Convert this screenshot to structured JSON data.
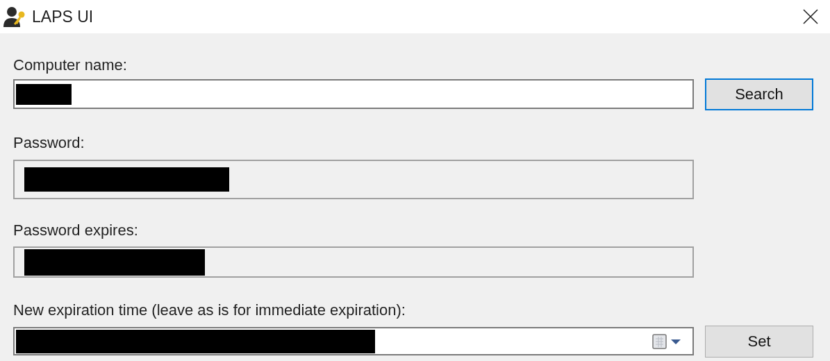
{
  "window": {
    "title": "LAPS UI"
  },
  "fields": [
    {
      "label": "Computer name:",
      "kind": "text",
      "redacted": true,
      "button": {
        "label": "Search",
        "focused": true
      }
    },
    {
      "label": "Password:",
      "kind": "readonly",
      "redacted": true
    },
    {
      "label": "Password expires:",
      "kind": "readonly",
      "redacted": true
    },
    {
      "label": "New expiration time (leave as is for immediate expiration):",
      "kind": "datetime",
      "redacted": true,
      "button": {
        "label": "Set",
        "focused": false
      }
    }
  ]
}
